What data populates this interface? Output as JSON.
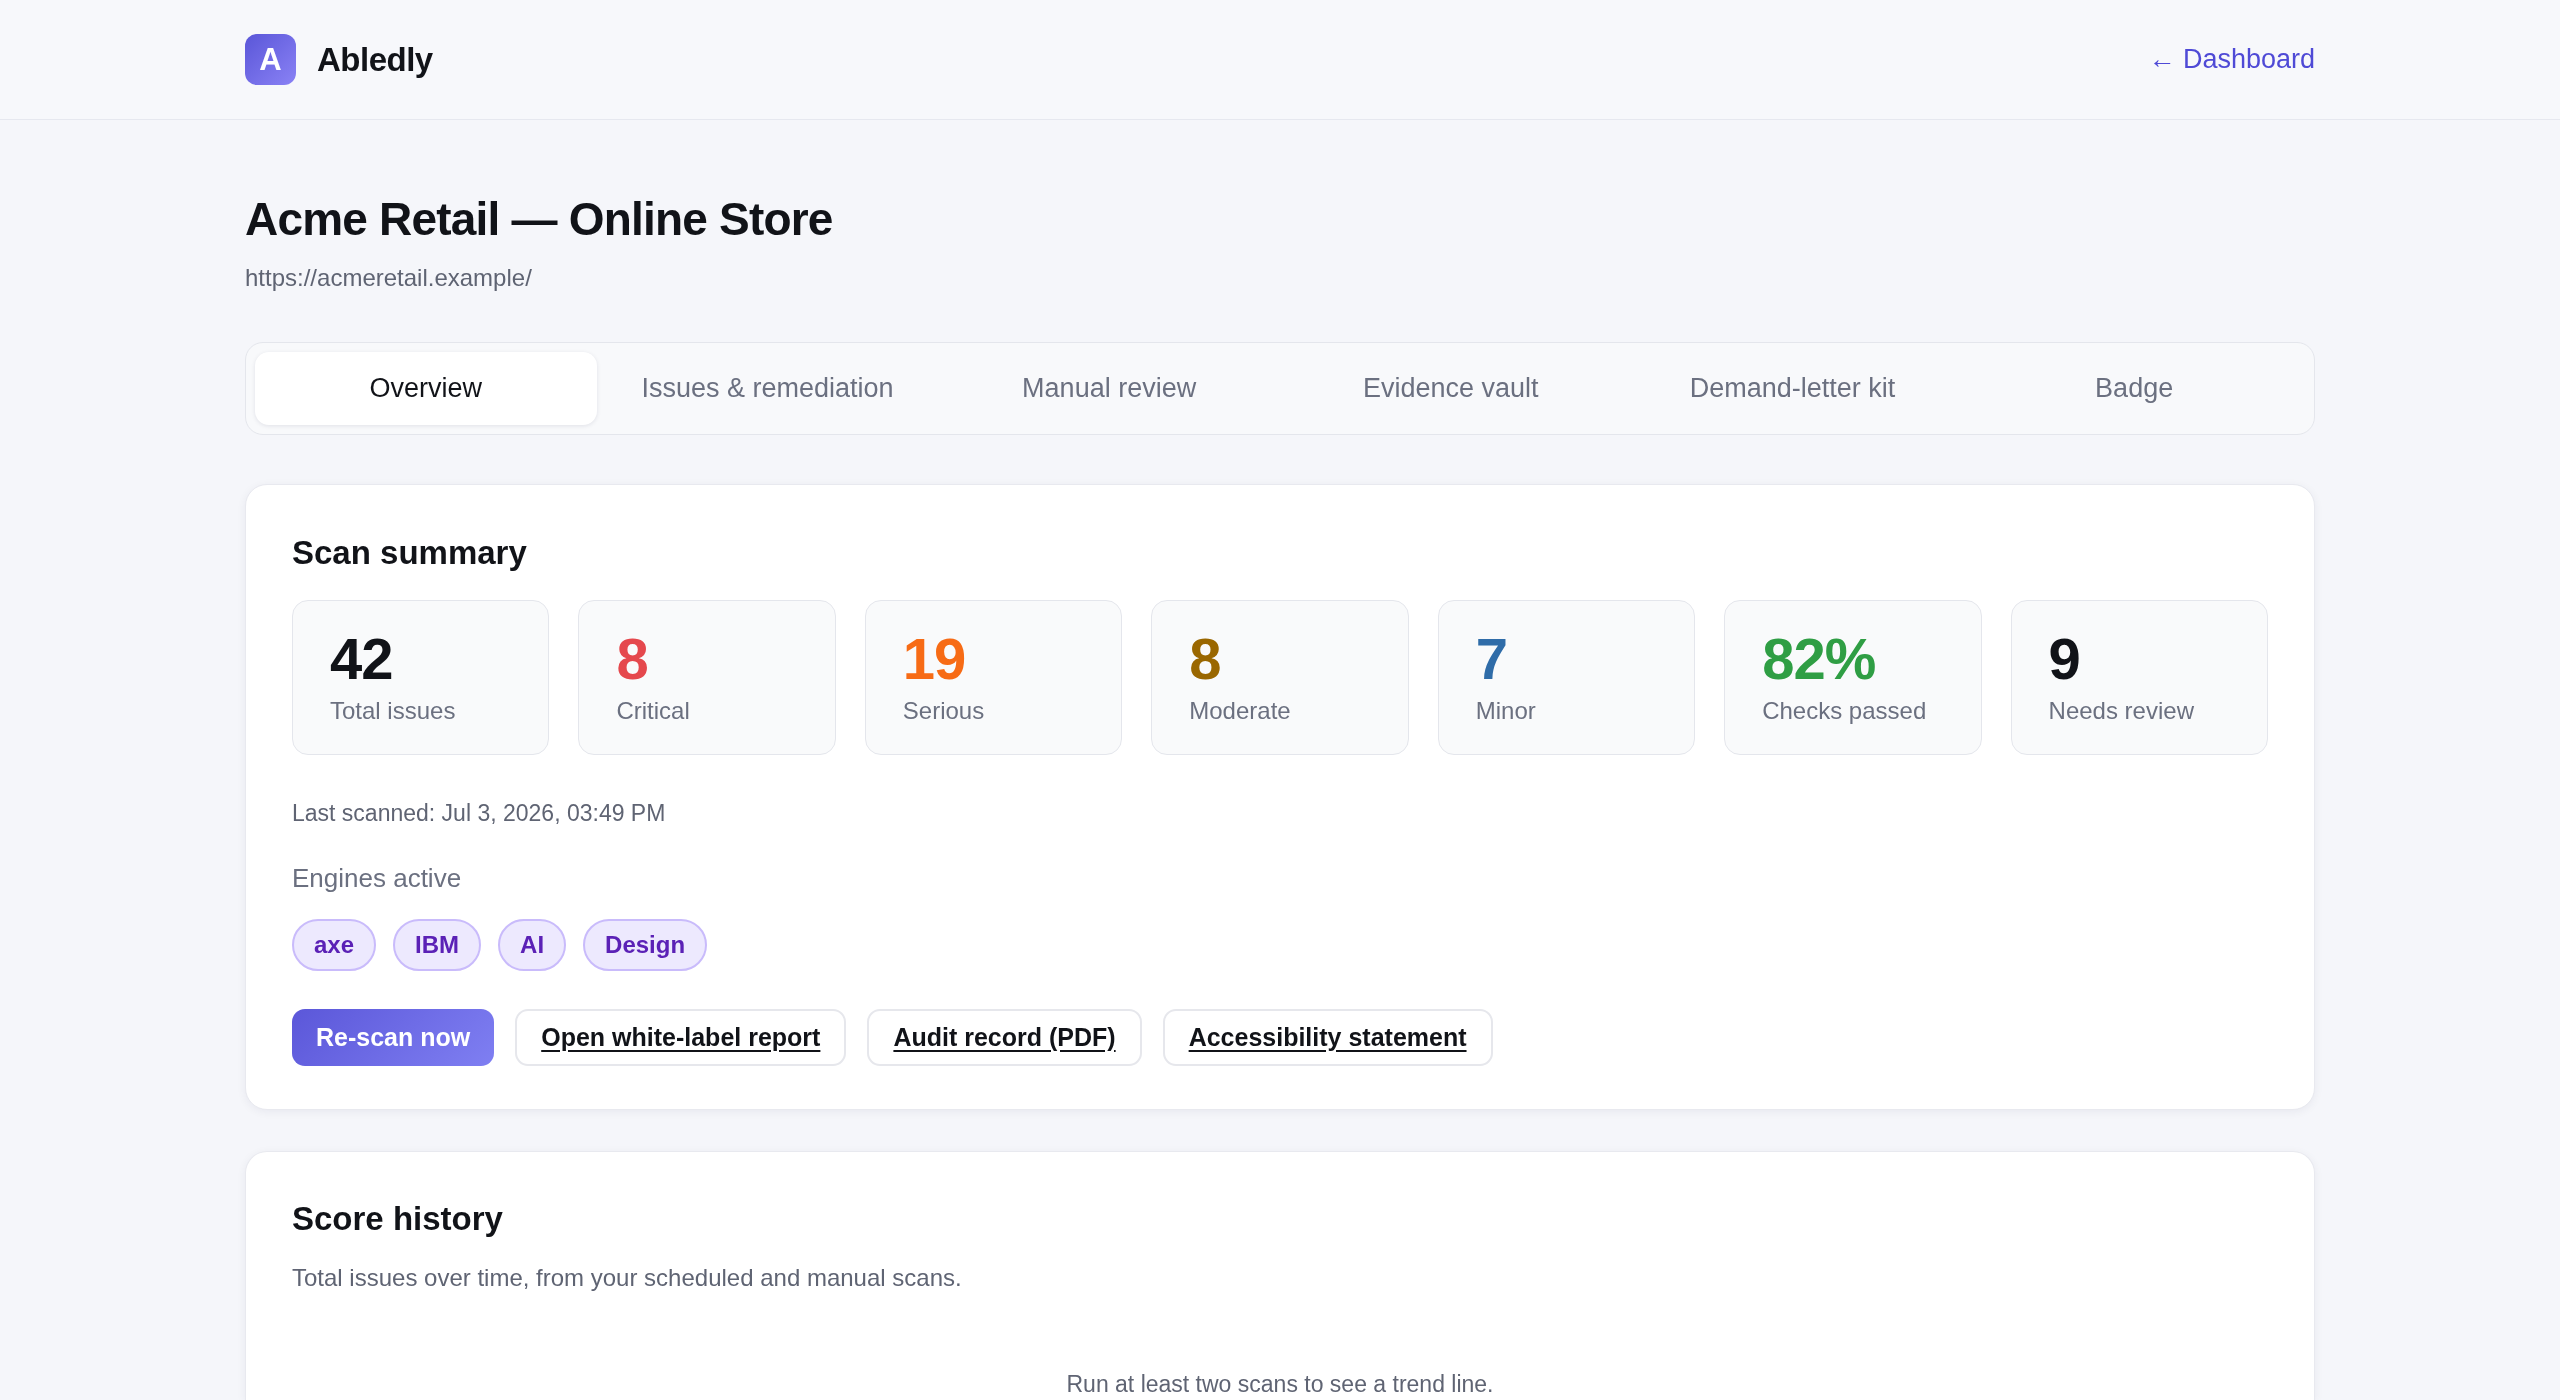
{
  "header": {
    "logo_letter": "A",
    "brand": "Abledly",
    "back_link": "← Dashboard"
  },
  "site": {
    "title": "Acme Retail — Online Store",
    "url": "https://acmeretail.example/"
  },
  "tabs": [
    {
      "label": "Overview",
      "selected": true
    },
    {
      "label": "Issues & remediation",
      "selected": false
    },
    {
      "label": "Manual review",
      "selected": false
    },
    {
      "label": "Evidence vault",
      "selected": false
    },
    {
      "label": "Demand-letter kit",
      "selected": false
    },
    {
      "label": "Badge",
      "selected": false
    }
  ],
  "scan_summary": {
    "title": "Scan summary",
    "stats": [
      {
        "value": "42",
        "label": "Total issues",
        "color": "#111318"
      },
      {
        "value": "8",
        "label": "Critical",
        "color": "#e5484d"
      },
      {
        "value": "19",
        "label": "Serious",
        "color": "#f76b15"
      },
      {
        "value": "8",
        "label": "Moderate",
        "color": "#9a6700"
      },
      {
        "value": "7",
        "label": "Minor",
        "color": "#2f6ca8"
      },
      {
        "value": "82%",
        "label": "Checks passed",
        "color": "#2f9e44"
      },
      {
        "value": "9",
        "label": "Needs review",
        "color": "#111318"
      }
    ],
    "last_scanned": "Last scanned: Jul 3, 2026, 03:49 PM",
    "engines_label": "Engines active",
    "engines": [
      "axe",
      "IBM",
      "AI",
      "Design"
    ],
    "actions": [
      {
        "kind": "primary",
        "label": "Re-scan now"
      },
      {
        "kind": "link",
        "label": "Open white-label report"
      },
      {
        "kind": "link",
        "label": "Audit record (PDF)"
      },
      {
        "kind": "link",
        "label": "Accessibility statement"
      }
    ]
  },
  "score_history": {
    "title": "Score history",
    "subtitle": "Total issues over time, from your scheduled and manual scans.",
    "empty_message": "Run at least two scans to see a trend line."
  }
}
